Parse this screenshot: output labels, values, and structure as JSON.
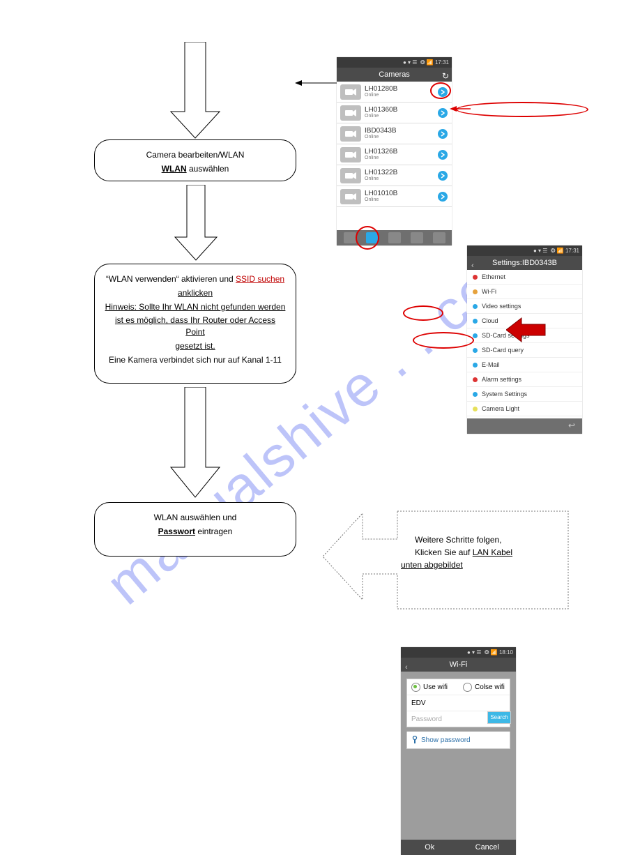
{
  "watermark": "manualshive . . com",
  "steps": {
    "step6": {
      "prefix": "Camera bearbeiten/WLAN",
      "select_label": "WLAN",
      "select_suffix": " auswählen"
    },
    "step7": {
      "line1a": "“WLAN verwenden“ aktivieren und ",
      "line1b": "SSID suchen",
      "line2": "anklicken",
      "line3": "Hinweis: Sollte Ihr WLAN nicht gefunden werden",
      "line4": "ist es möglich, dass Ihr Router oder Access Point",
      "line5": "gesetzt ist.",
      "line6": "Eine Kamera verbindet sich nur auf Kanal 1-11"
    },
    "step8": {
      "line1": "WLAN auswählen und",
      "line2": "Passwort",
      "line3": " eintragen"
    }
  },
  "note": {
    "line1": "Weitere Schritte folgen,",
    "line2_prefix": "Klicken Sie auf ",
    "line2_link": "LAN Kabel",
    "line3": "unten abgebildet"
  },
  "phones": {
    "cameras": {
      "title": "Cameras",
      "status_time": "17:31",
      "items": [
        {
          "name": "LH01280B",
          "sub": "Online"
        },
        {
          "name": "LH01360B",
          "sub": "Online"
        },
        {
          "name": "IBD0343B",
          "sub": "Online"
        },
        {
          "name": "LH01326B",
          "sub": "Online"
        },
        {
          "name": "LH01322B",
          "sub": "Online"
        },
        {
          "name": "LH01010B",
          "sub": "Online"
        }
      ]
    },
    "settings": {
      "title": "Settings:IBD0343B",
      "status_time": "17:31",
      "items": [
        {
          "label": "Ethernet",
          "color": "#d33"
        },
        {
          "label": "Wi-Fi",
          "color": "#e6a23c"
        },
        {
          "label": "Video settings",
          "color": "#2aa8e6"
        },
        {
          "label": "Cloud",
          "color": "#2aa8e6"
        },
        {
          "label": "SD-Card settings",
          "color": "#2aa8e6"
        },
        {
          "label": "SD-Card query",
          "color": "#2aa8e6"
        },
        {
          "label": "E-Mail",
          "color": "#2aa8e6"
        },
        {
          "label": "Alarm settings",
          "color": "#d33"
        },
        {
          "label": "System Settings",
          "color": "#2aa8e6"
        },
        {
          "label": "Camera Light",
          "color": "#e6e05a"
        }
      ]
    },
    "wifi": {
      "title": "Wi-Fi",
      "status_time": "18:10",
      "use_label": "Use wifi",
      "close_label": "Colse wifi",
      "ssid_value": "EDV",
      "password_label": "Password",
      "search_label": "Search",
      "show_password": "Show password",
      "ok": "Ok",
      "cancel": "Cancel"
    }
  }
}
